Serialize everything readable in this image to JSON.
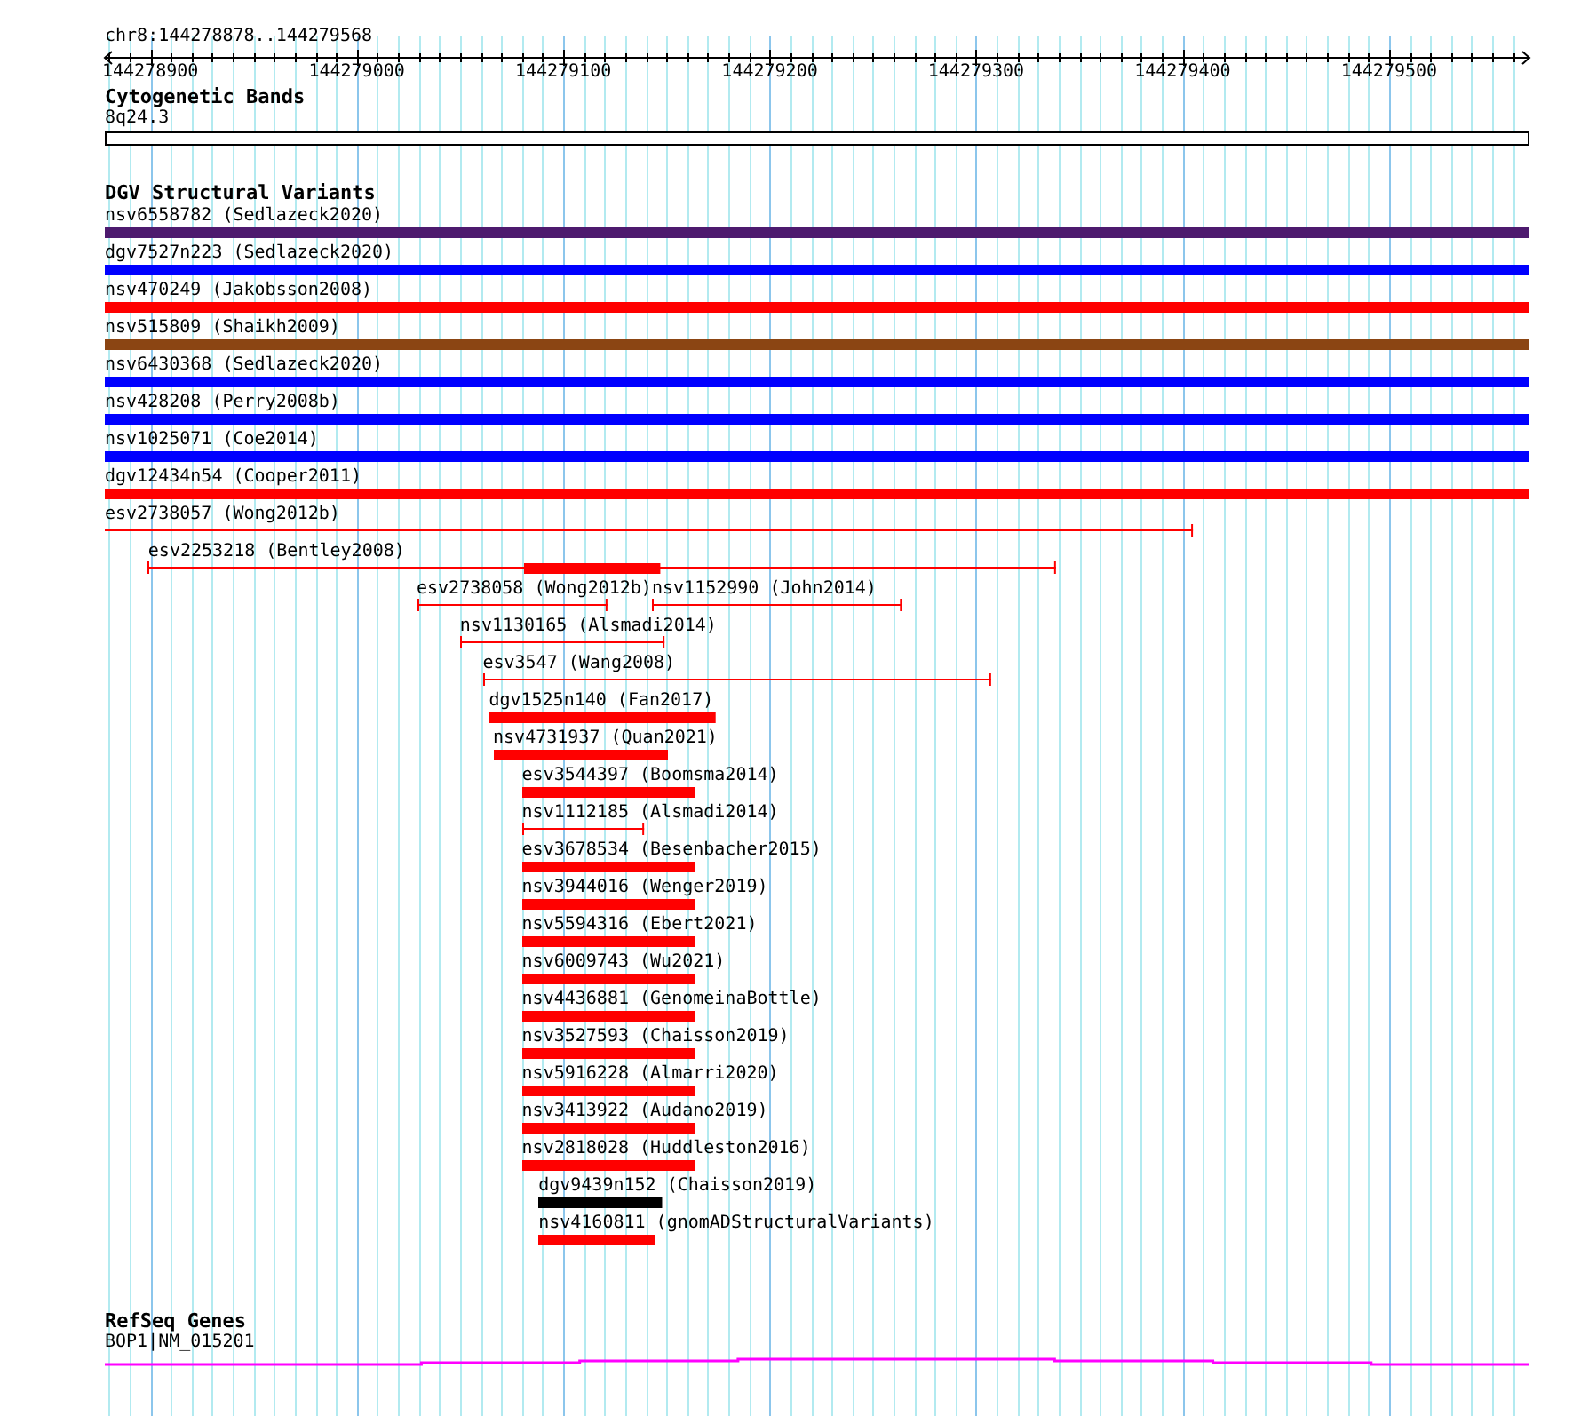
{
  "ruler": {
    "title": "chr8:144278878..144279568",
    "ticks": [
      "144278900",
      "144279000",
      "144279100",
      "144279200",
      "144279300",
      "144279400",
      "144279500"
    ]
  },
  "tracks": [
    {
      "kind": "band",
      "title": "Cytogenetic Bands",
      "label": "8q24.3"
    },
    {
      "kind": "variants",
      "title": "DGV Structural Variants",
      "rows": [
        [
          {
            "label": "nsv6558782 (Sedlazeck2020)",
            "kind": "block",
            "color": "#4d1a6e"
          }
        ],
        [
          {
            "label": "dgv7527n223 (Sedlazeck2020)",
            "kind": "block",
            "color": "#0000ff"
          }
        ],
        [
          {
            "label": "nsv470249 (Jakobsson2008)",
            "kind": "block",
            "color": "#ff0000"
          }
        ],
        [
          {
            "label": "nsv515809 (Shaikh2009)",
            "kind": "block",
            "color": "#8b4513"
          }
        ],
        [
          {
            "label": "nsv6430368 (Sedlazeck2020)",
            "kind": "block",
            "color": "#0000ff"
          }
        ],
        [
          {
            "label": "nsv428208 (Perry2008b)",
            "kind": "block",
            "color": "#0000ff"
          }
        ],
        [
          {
            "label": "nsv1025071 (Coe2014)",
            "kind": "block",
            "color": "#0000ff"
          }
        ],
        [
          {
            "label": "dgv12434n54 (Cooper2011)",
            "kind": "block",
            "color": "#ff0000"
          }
        ],
        [
          {
            "label": "esv2738057 (Wong2012b)",
            "kind": "range",
            "continues_left": true,
            "color": "#ff0000"
          }
        ],
        [
          {
            "label": "esv2253218 (Bentley2008)",
            "kind": "range",
            "color": "#ff0000"
          },
          {
            "kind": "block",
            "color": "#ff0000"
          }
        ],
        [
          {
            "label": "esv2738058 (Wong2012b)",
            "kind": "range",
            "color": "#ff0000"
          },
          {
            "label": "nsv1152990 (John2014)",
            "kind": "range",
            "color": "#ff0000"
          }
        ],
        [
          {
            "label": "nsv1130165 (Alsmadi2014)",
            "kind": "range",
            "color": "#ff0000"
          }
        ],
        [
          {
            "label": "esv3547 (Wang2008)",
            "kind": "range",
            "color": "#ff0000"
          }
        ],
        [
          {
            "label": "dgv1525n140 (Fan2017)",
            "kind": "block",
            "color": "#ff0000"
          }
        ],
        [
          {
            "label": "nsv4731937 (Quan2021)",
            "kind": "block",
            "color": "#ff0000"
          }
        ],
        [
          {
            "label": "esv3544397 (Boomsma2014)",
            "kind": "block",
            "color": "#ff0000"
          }
        ],
        [
          {
            "label": "nsv1112185 (Alsmadi2014)",
            "kind": "range",
            "color": "#ff0000"
          }
        ],
        [
          {
            "label": "esv3678534 (Besenbacher2015)",
            "kind": "block",
            "color": "#ff0000"
          }
        ],
        [
          {
            "label": "nsv3944016 (Wenger2019)",
            "kind": "block",
            "color": "#ff0000"
          }
        ],
        [
          {
            "label": "nsv5594316 (Ebert2021)",
            "kind": "block",
            "color": "#ff0000"
          }
        ],
        [
          {
            "label": "nsv6009743 (Wu2021)",
            "kind": "block",
            "color": "#ff0000"
          }
        ],
        [
          {
            "label": "nsv4436881 (GenomeinaBottle)",
            "kind": "block",
            "color": "#ff0000"
          }
        ],
        [
          {
            "label": "nsv3527593 (Chaisson2019)",
            "kind": "block",
            "color": "#ff0000"
          }
        ],
        [
          {
            "label": "nsv5916228 (Almarri2020)",
            "kind": "block",
            "color": "#ff0000"
          }
        ],
        [
          {
            "label": "nsv3413922 (Audano2019)",
            "kind": "block",
            "color": "#ff0000"
          }
        ],
        [
          {
            "label": "nsv2818028 (Huddleston2016)",
            "kind": "block",
            "color": "#ff0000"
          }
        ],
        [
          {
            "label": "dgv9439n152 (Chaisson2019)",
            "kind": "block",
            "color": "#000000"
          }
        ],
        [
          {
            "label": "nsv4160811 (gnomADStructuralVariants)",
            "kind": "block",
            "color": "#ff0000"
          }
        ]
      ]
    },
    {
      "kind": "gene",
      "title": "RefSeq Genes",
      "label": "BOP1|NM_015201"
    }
  ]
}
